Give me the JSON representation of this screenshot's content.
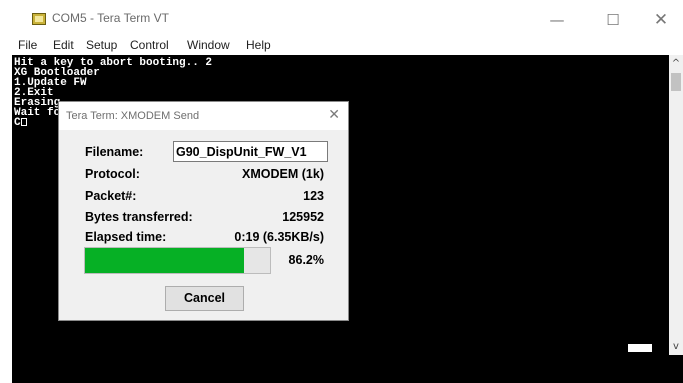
{
  "window": {
    "title": "COM5 - Tera Term VT",
    "minimize_glyph": "—",
    "maximize_glyph": "☐",
    "close_glyph": "✕"
  },
  "menu": {
    "items": [
      "File",
      "Edit",
      "Setup",
      "Control",
      "Window",
      "Help"
    ]
  },
  "terminal": {
    "lines": [
      "Hit a key to abort booting.. 2",
      "XG Bootloader",
      "1.Update FW",
      "2.Exit",
      "Erasing",
      "Wait for",
      "C"
    ],
    "background": "#000000",
    "foreground": "#ffffff"
  },
  "scrollbar": {
    "up_glyph": "^",
    "down_glyph": "v"
  },
  "dialog": {
    "title": "Tera Term: XMODEM Send",
    "close_glyph": "✕",
    "filename_label": "Filename:",
    "filename_value": "G90_DispUnit_FW_V1",
    "protocol_label": "Protocol:",
    "protocol_value": "XMODEM (1k)",
    "packet_label": "Packet#:",
    "packet_value": "123",
    "bytes_label": "Bytes transferred:",
    "bytes_value": "125952",
    "elapsed_label": "Elapsed time:",
    "elapsed_value": "0:19 (6.35KB/s)",
    "progress_percent_text": "86.2%",
    "progress_fraction": 0.862,
    "progress_color": "#06b025",
    "cancel_label": "Cancel"
  },
  "icons": {
    "app_icon": "tera-term-icon"
  }
}
